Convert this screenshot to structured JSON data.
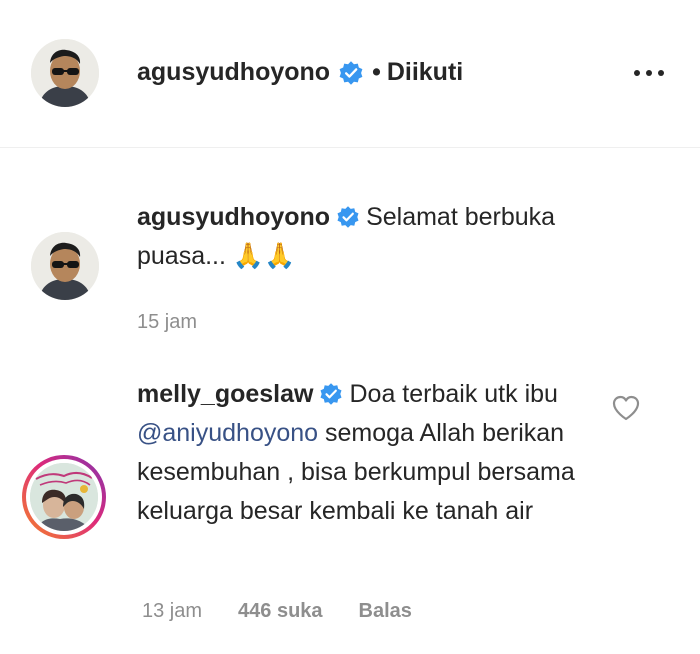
{
  "header": {
    "username": "agusyudhoyono",
    "separator": "•",
    "follow_status": "Diikuti"
  },
  "caption": {
    "username": "agusyudhoyono",
    "text": "Selamat berbuka puasa...",
    "emoji": "🙏🙏",
    "time": "15 jam"
  },
  "comment": {
    "username": "melly_goeslaw",
    "text_before_mention": "Doa terbaik utk ibu ",
    "mention": "@aniyudhoyono",
    "text_after_mention": " semoga Allah berikan kesembuhan , bisa berkumpul bersama keluarga besar kembali ke tanah air",
    "time": "13 jam",
    "likes": "446 suka",
    "reply_label": "Balas"
  },
  "colors": {
    "verified": "#3897f0",
    "mention": "#385185",
    "meta": "#8e8e8e",
    "text": "#262626"
  },
  "icons": [
    "verified-badge-icon",
    "more-options-icon",
    "heart-icon"
  ]
}
